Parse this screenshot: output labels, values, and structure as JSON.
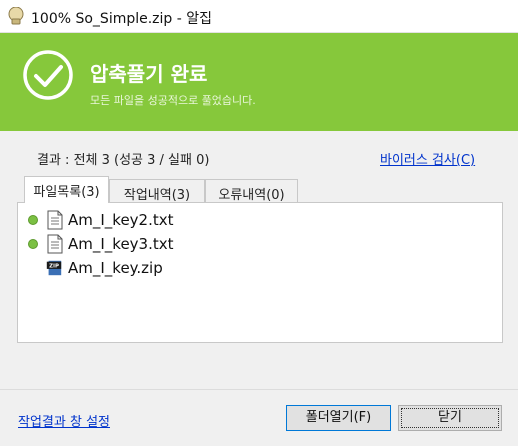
{
  "window": {
    "title": "100% So_Simple.zip - 알집",
    "icon": "alzip-app-icon"
  },
  "banner": {
    "title": "압축풀기 완료",
    "subtitle": "모든 파일을 성공적으로 풀었습니다.",
    "icon": "checkmark-icon",
    "color": "#86c83b"
  },
  "summary": {
    "result": "결과 : 전체 3 (성공 3 / 실패 0)",
    "virus_check_link": "바이러스 검사(C)"
  },
  "tabs": [
    {
      "label": "파일목록(3)",
      "active": true
    },
    {
      "label": "작업내역(3)",
      "active": false
    },
    {
      "label": "오류내역(0)",
      "active": false
    }
  ],
  "files": [
    {
      "name": "Am_I_key2.txt",
      "icon": "text-file-icon",
      "status": "success"
    },
    {
      "name": "Am_I_key3.txt",
      "icon": "text-file-icon",
      "status": "success"
    },
    {
      "name": "Am_I_key.zip",
      "icon": "zip-file-icon",
      "status": ""
    }
  ],
  "footer": {
    "settings_link": "작업결과 창 설정",
    "open_folder_button": "폴더열기(F)",
    "close_button": "닫기"
  }
}
